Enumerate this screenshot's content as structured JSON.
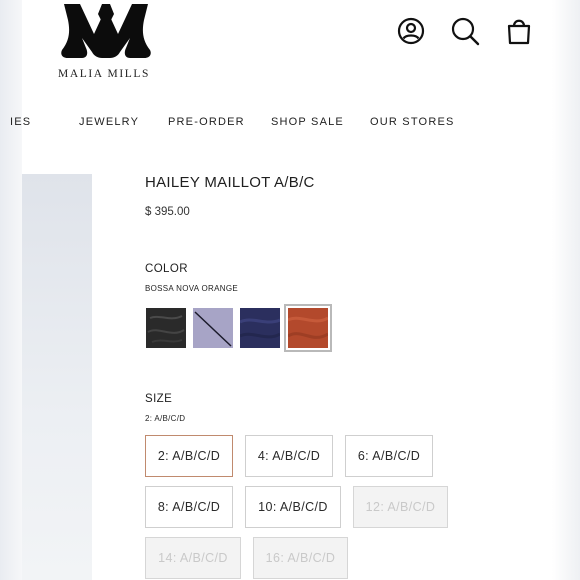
{
  "brand": {
    "name": "MALIA MILLS",
    "logo_icon": "malia-mills-monogram"
  },
  "header": {
    "icons": [
      {
        "name": "account-icon"
      },
      {
        "name": "search-icon"
      },
      {
        "name": "cart-bag-icon"
      }
    ]
  },
  "nav": {
    "items": [
      {
        "label": "IES"
      },
      {
        "label": "JEWELRY"
      },
      {
        "label": "PRE-ORDER"
      },
      {
        "label": "SHOP SALE"
      },
      {
        "label": "OUR STORES"
      }
    ]
  },
  "product": {
    "title": "HAILEY MAILLOT A/B/C",
    "price": "$ 395.00"
  },
  "color": {
    "label": "COLOR",
    "selected": "BOSSA NOVA ORANGE",
    "swatches": [
      {
        "name": "black",
        "color": "#2a2a2a"
      },
      {
        "name": "lavender-gray",
        "color": "#a7a4c6"
      },
      {
        "name": "navy",
        "color": "#2b2f5e"
      },
      {
        "name": "bossa-nova-orange",
        "color": "#b3492c",
        "selected": true
      }
    ]
  },
  "size": {
    "label": "SIZE",
    "selected": "2: A/B/C/D",
    "options": [
      {
        "label": "2: A/B/C/D",
        "state": "selected"
      },
      {
        "label": "4: A/B/C/D",
        "state": "available"
      },
      {
        "label": "6: A/B/C/D",
        "state": "available"
      },
      {
        "label": "8: A/B/C/D",
        "state": "available"
      },
      {
        "label": "10: A/B/C/D",
        "state": "available"
      },
      {
        "label": "12: A/B/C/D",
        "state": "disabled"
      },
      {
        "label": "14: A/B/C/D",
        "state": "disabled"
      },
      {
        "label": "16: A/B/C/D",
        "state": "disabled"
      }
    ]
  },
  "colors": {
    "selected_border": "#c08a6e",
    "text": "#1f1f1f",
    "disabled_text": "#c9c9c9"
  }
}
